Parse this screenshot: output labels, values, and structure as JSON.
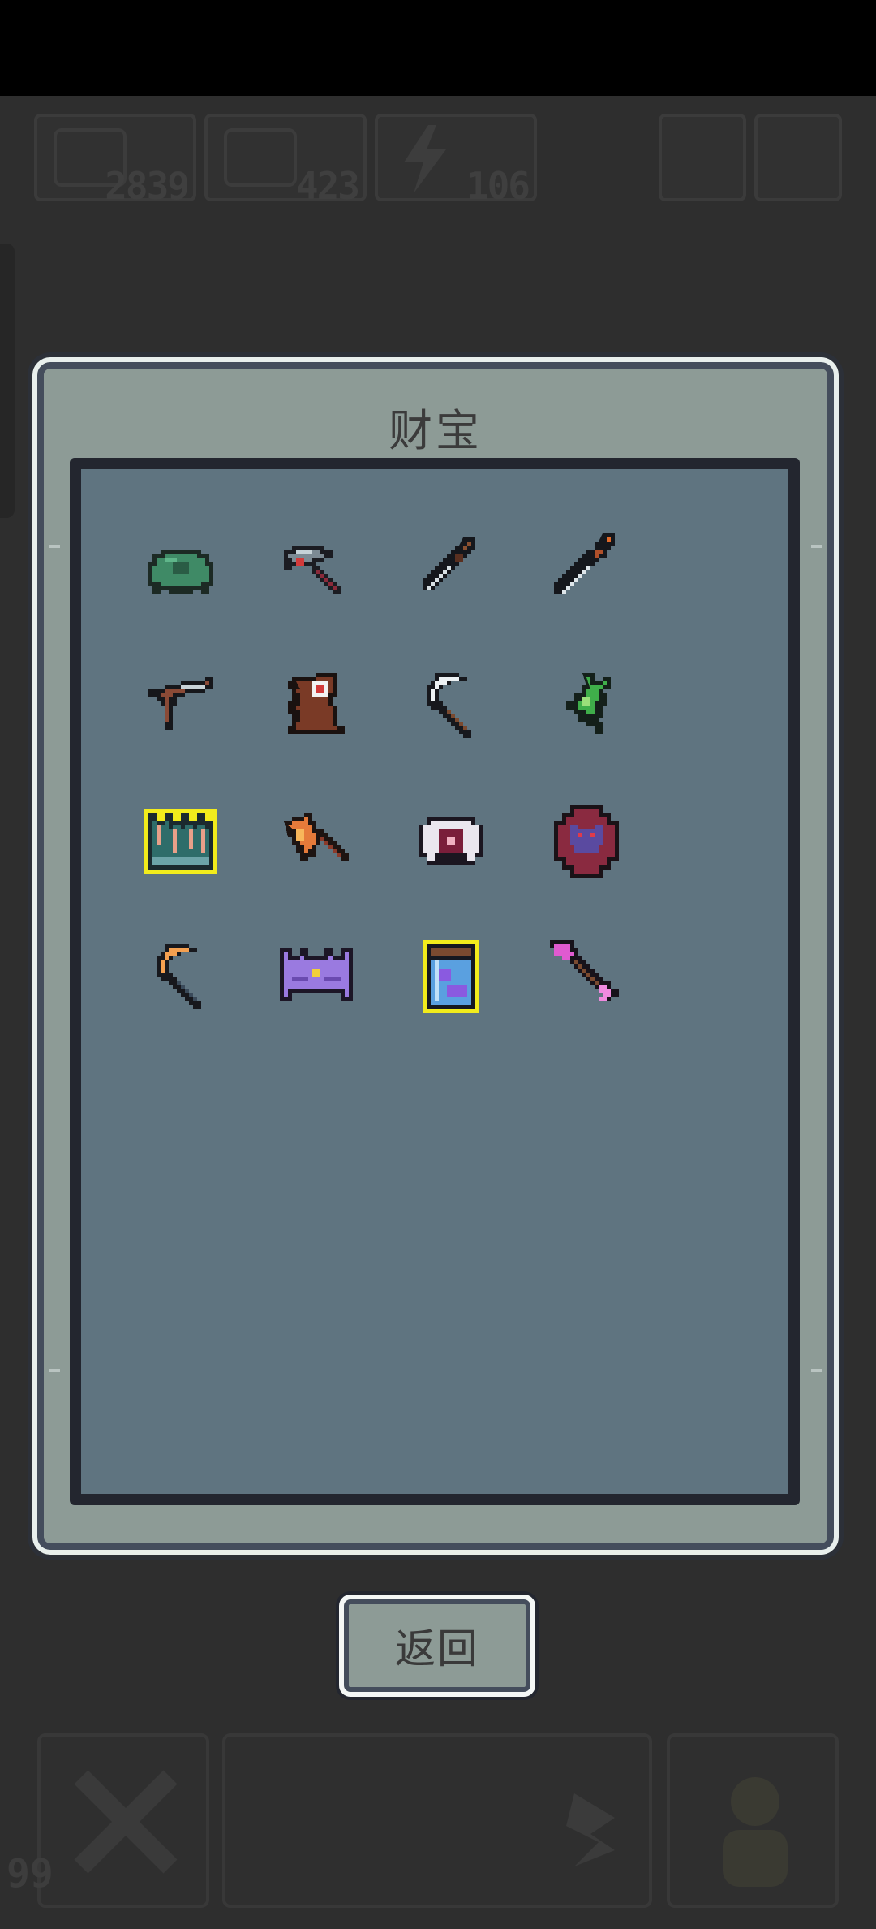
{
  "hud": {
    "resource_1": "2839",
    "resource_2": "423",
    "resource_3": "106",
    "bottom_count": "99"
  },
  "panel": {
    "title": "财宝",
    "items": [
      {
        "name": "turtle-shell-item-icon",
        "highlighted": false
      },
      {
        "name": "pickaxe-item-icon",
        "highlighted": false
      },
      {
        "name": "dagger-item-icon",
        "highlighted": false
      },
      {
        "name": "sword-item-icon",
        "highlighted": false
      },
      {
        "name": "slingshot-item-icon",
        "highlighted": false
      },
      {
        "name": "target-stump-item-icon",
        "highlighted": false
      },
      {
        "name": "sickle-item-icon",
        "highlighted": false
      },
      {
        "name": "green-sprout-item-icon",
        "highlighted": false
      },
      {
        "name": "ice-crown-item-icon",
        "highlighted": true
      },
      {
        "name": "flame-axe-item-icon",
        "highlighted": false
      },
      {
        "name": "eye-emblem-item-icon",
        "highlighted": false
      },
      {
        "name": "demon-medallion-item-icon",
        "highlighted": false
      },
      {
        "name": "golden-sickle-item-icon",
        "highlighted": false
      },
      {
        "name": "purple-crown-item-icon",
        "highlighted": false
      },
      {
        "name": "potion-jar-item-icon",
        "highlighted": true
      },
      {
        "name": "pink-arrow-item-icon",
        "highlighted": false
      }
    ]
  },
  "back_button": {
    "label": "返回"
  },
  "colors": {
    "highlight": "#f2ec1c",
    "panel": "#8d9b96",
    "inner": "#5f7480"
  }
}
